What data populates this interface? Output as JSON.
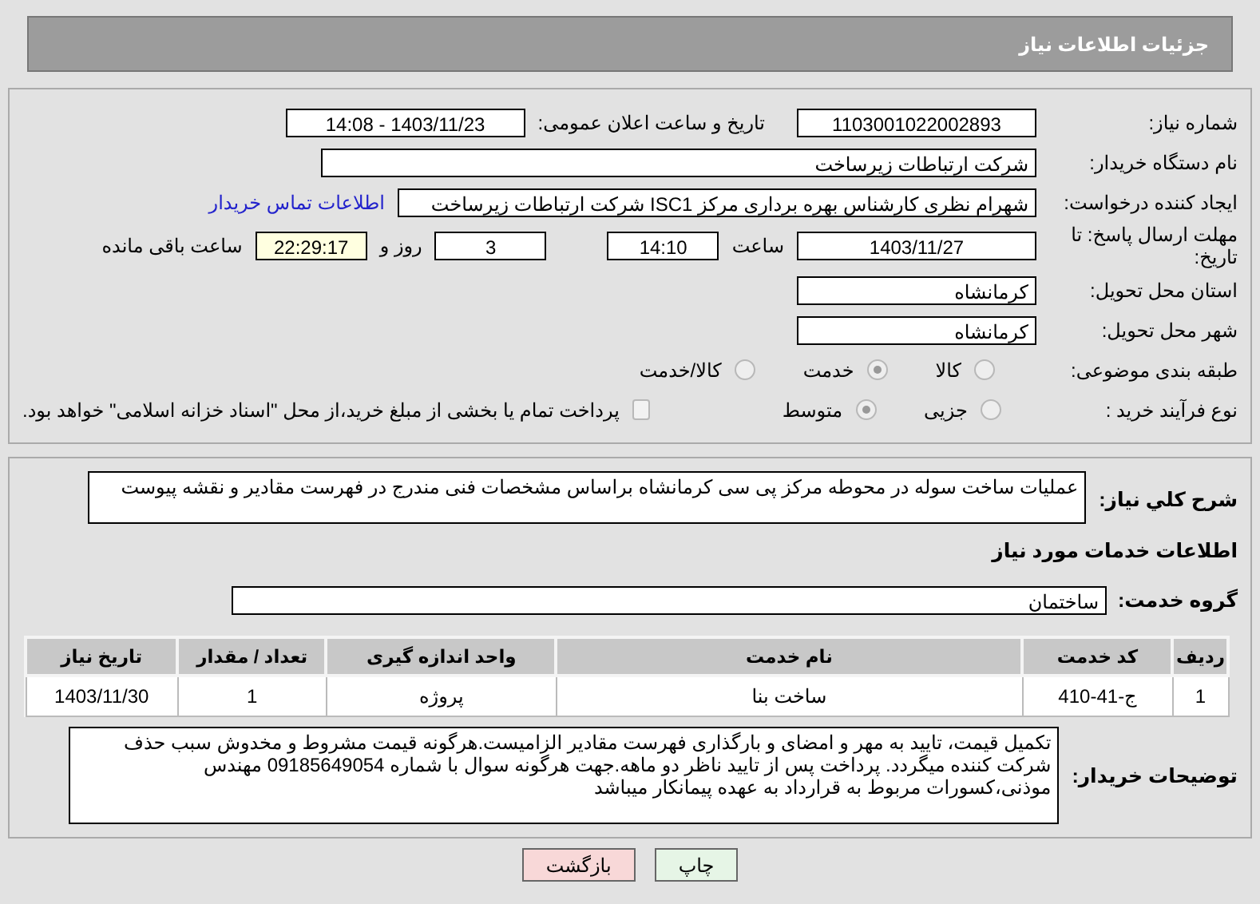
{
  "header": {
    "title": "جزئیات اطلاعات نیاز"
  },
  "need_number": {
    "label": "شماره نیاز:",
    "value": "1103001022002893"
  },
  "announce_date": {
    "label": "تاریخ و ساعت اعلان عمومی:",
    "value": "1403/11/23 - 14:08"
  },
  "buyer_org": {
    "label": "نام دستگاه خریدار:",
    "value": "شرکت ارتباطات زیرساخت"
  },
  "requester": {
    "label": "ایجاد کننده درخواست:",
    "value": "شهرام نظری کارشناس بهره برداری مرکز ISC1 شرکت ارتباطات زیرساخت",
    "link": "اطلاعات تماس خریدار"
  },
  "deadline": {
    "label": "مهلت ارسال پاسخ: تا تاریخ:",
    "date": "1403/11/27",
    "time_label": "ساعت",
    "time": "14:10",
    "days": "3",
    "days_label": "روز و",
    "remaining": "22:29:17",
    "remaining_label": "ساعت باقی مانده"
  },
  "province": {
    "label": "استان محل تحویل:",
    "value": "کرمانشاه"
  },
  "city": {
    "label": "شهر محل تحویل:",
    "value": "کرمانشاه"
  },
  "category": {
    "label": "طبقه بندی موضوعی:",
    "options": [
      {
        "label": "کالا",
        "selected": false
      },
      {
        "label": "خدمت",
        "selected": true
      },
      {
        "label": "کالا/خدمت",
        "selected": false
      }
    ]
  },
  "purchase_type": {
    "label": "نوع فرآیند خرید :",
    "options": [
      {
        "label": "جزیی",
        "selected": false
      },
      {
        "label": "متوسط",
        "selected": true
      }
    ],
    "payment": {
      "label": "پرداخت تمام یا بخشی از مبلغ خرید،از محل \"اسناد خزانه اسلامی\" خواهد بود.",
      "checked": false
    }
  },
  "description": {
    "label": "شرح کلي نياز:",
    "value": "عملیات ساخت سوله در محوطه مرکز پی سی کرمانشاه براساس مشخصات فنی مندرج در فهرست مقادیر و نقشه پیوست"
  },
  "services_title": "اطلاعات خدمات مورد نیاز",
  "service_group": {
    "label": "گروه خدمت:",
    "value": "ساختمان"
  },
  "table": {
    "columns": [
      "ردیف",
      "کد خدمت",
      "نام خدمت",
      "واحد اندازه گیری",
      "تعداد / مقدار",
      "تاریخ نیاز"
    ],
    "rows": [
      [
        "1",
        "ج-41-410",
        "ساخت بنا",
        "پروژه",
        "1",
        "1403/11/30"
      ]
    ]
  },
  "buyer_notes": {
    "label": "توضیحات خریدار:",
    "value": "تکمیل قیمت، تایید به مهر و امضای و بارگذاری فهرست مقادیر الزامیست.هرگونه قیمت مشروط و مخدوش سبب حذف شرکت کننده میگردد. پرداخت پس از تایید ناظر دو ماهه.جهت هرگونه سوال با شماره 09185649054 مهندس موذنی،کسورات مربوط به قرارداد به عهده پیمانکار میباشد"
  },
  "buttons": [
    {
      "label": "چاپ",
      "kind": "print"
    },
    {
      "label": "بازگشت",
      "kind": "back"
    }
  ]
}
